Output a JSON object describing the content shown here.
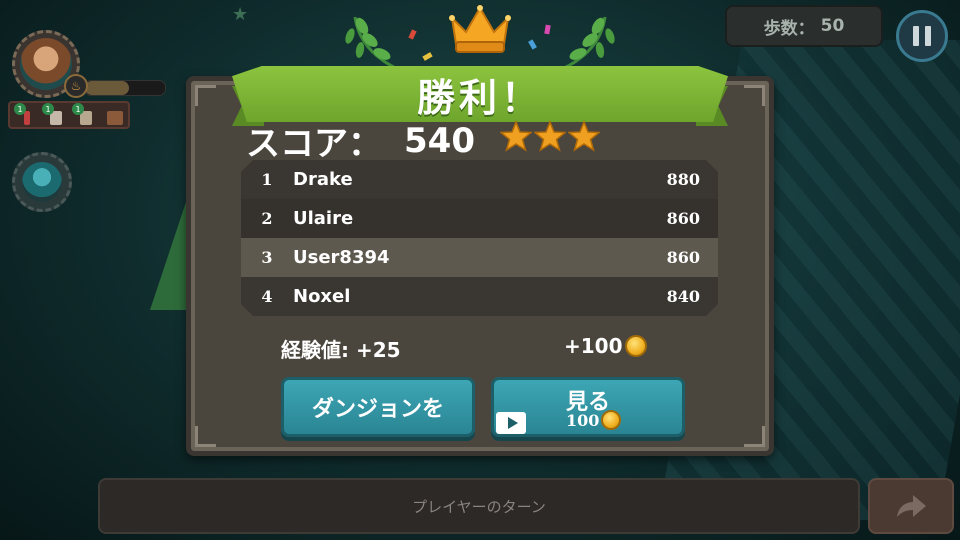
{
  "hud": {
    "steps_label": "歩数：",
    "steps_value": "50",
    "player_level_icon": "flame-icon",
    "xp_progress": 0.55,
    "inventory": [
      {
        "icon": "potion-icon",
        "count": "1"
      },
      {
        "icon": "figurine-icon",
        "count": "1"
      },
      {
        "icon": "statue-icon",
        "count": "1"
      },
      {
        "icon": "chest-icon",
        "count": ""
      }
    ],
    "pause_icon": "pause-icon"
  },
  "result": {
    "title": "勝利！",
    "score_label": "スコア：",
    "score_value": "540",
    "stars": 3,
    "leaderboard": [
      {
        "rank": "1",
        "name": "Drake",
        "score": "880"
      },
      {
        "rank": "2",
        "name": "Ulaire",
        "score": "860"
      },
      {
        "rank": "3",
        "name": "User8394",
        "score": "860"
      },
      {
        "rank": "4",
        "name": "Noxel",
        "score": "840"
      }
    ],
    "xp_text": "経験値: +25",
    "coin_reward": "+100",
    "dungeon_button": "ダンジョンを",
    "watch_button": "見る",
    "watch_reward": "100"
  },
  "footer": {
    "turn_text": "プレイヤーのターン",
    "end_turn_icon": "arrow-right-icon"
  },
  "colors": {
    "ribbon": "#7cb637",
    "button": "#2f93a2",
    "star": "#f0a020",
    "coin": "#f0b020"
  }
}
